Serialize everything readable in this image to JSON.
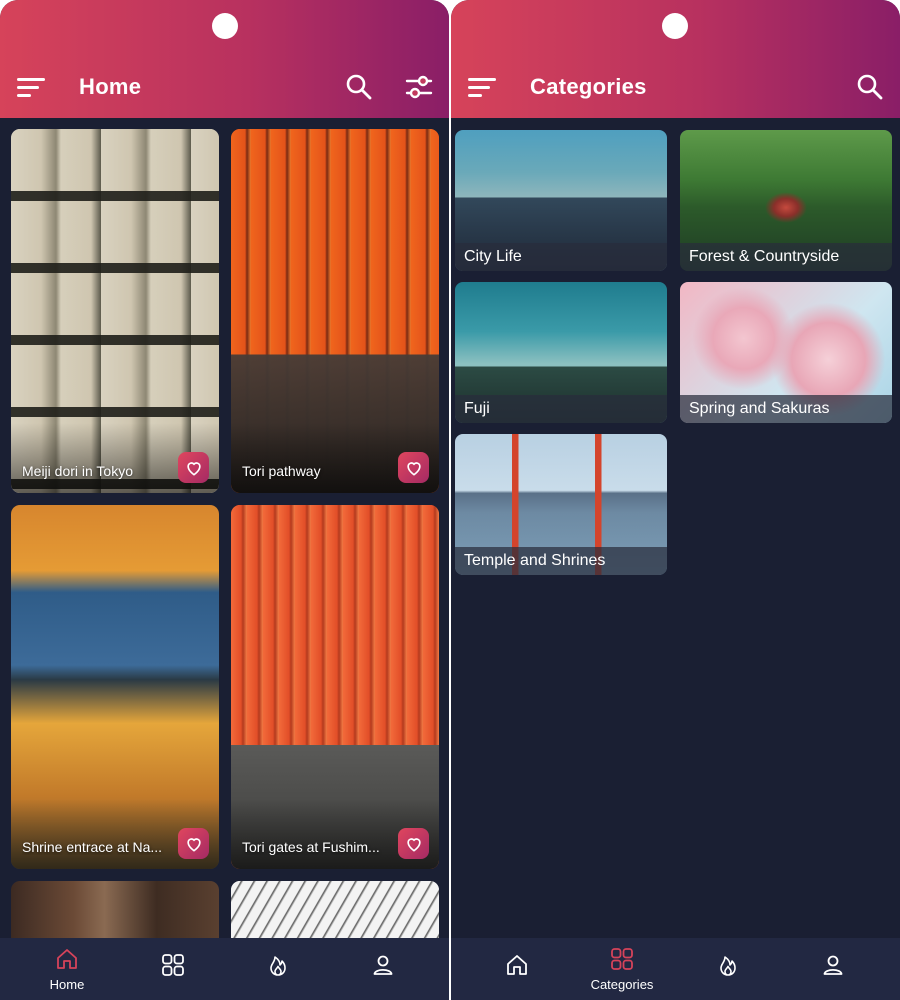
{
  "colors": {
    "header_gradient_start": "#d6435a",
    "header_gradient_end": "#8a1e67",
    "background": "#1a1f33",
    "nav_background": "#222842",
    "accent": "#d6435a",
    "icon_inactive": "#ffffff"
  },
  "home_screen": {
    "title": "Home",
    "header_icons": [
      "menu-icon",
      "search-icon",
      "filter-sliders-icon"
    ],
    "cards": [
      {
        "caption": "Meiji dori in Tokyo",
        "icon": "heart-icon"
      },
      {
        "caption": "Tori pathway",
        "icon": "heart-icon"
      },
      {
        "caption": "Shrine entrace at Na...",
        "icon": "heart-icon"
      },
      {
        "caption": "Tori gates at Fushim...",
        "icon": "heart-icon"
      },
      {
        "caption": ""
      },
      {
        "caption": ""
      }
    ],
    "nav": [
      {
        "label": "Home",
        "icon": "home-icon",
        "active": true
      },
      {
        "label": "",
        "icon": "grid-icon",
        "active": false
      },
      {
        "label": "",
        "icon": "flame-icon",
        "active": false
      },
      {
        "label": "",
        "icon": "user-icon",
        "active": false
      }
    ]
  },
  "categories_screen": {
    "title": "Categories",
    "header_icons": [
      "menu-icon",
      "search-icon"
    ],
    "categories": [
      {
        "label": "City Life"
      },
      {
        "label": "Forest & Countryside"
      },
      {
        "label": "Fuji"
      },
      {
        "label": "Spring and Sakuras"
      },
      {
        "label": "Temple and Shrines"
      }
    ],
    "nav": [
      {
        "label": "",
        "icon": "home-icon",
        "active": false
      },
      {
        "label": "Categories",
        "icon": "grid-icon",
        "active": true
      },
      {
        "label": "",
        "icon": "flame-icon",
        "active": false
      },
      {
        "label": "",
        "icon": "user-icon",
        "active": false
      }
    ]
  }
}
